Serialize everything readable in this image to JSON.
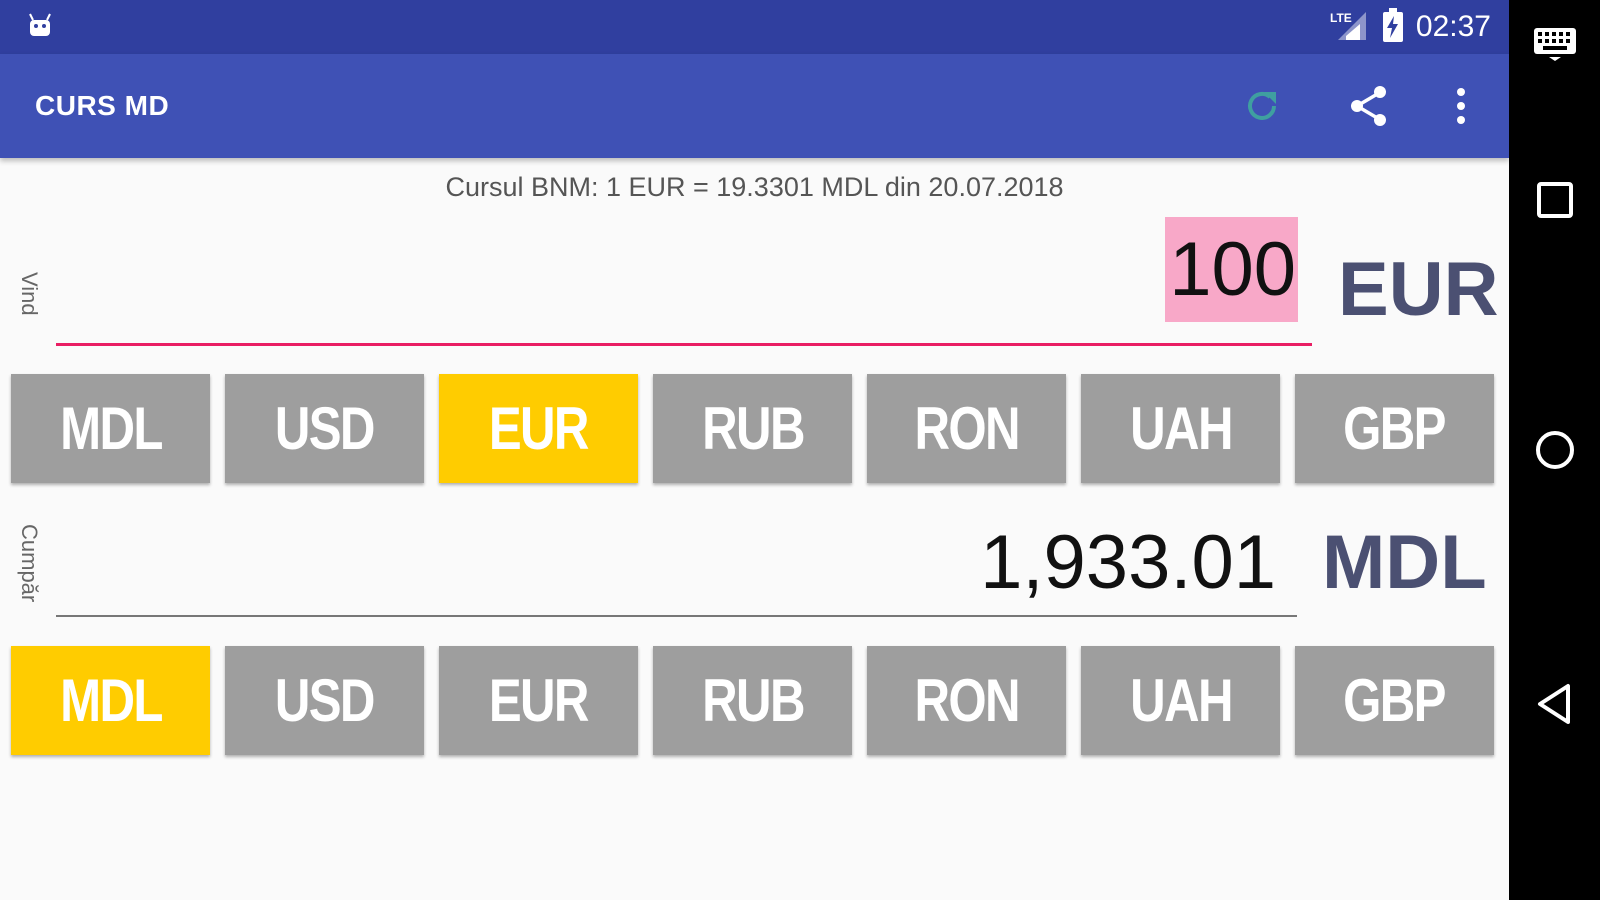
{
  "status_bar": {
    "time": "02:37",
    "network": "LTE",
    "icons": [
      "android-icon",
      "lte-signal-icon",
      "battery-charging-icon"
    ]
  },
  "app_bar": {
    "title": "CURS MD",
    "actions": [
      "refresh-icon",
      "share-icon",
      "more-vert-icon"
    ]
  },
  "rate_info": "Cursul BNM: 1 EUR = 19.3301 MDL din 20.07.2018",
  "sell": {
    "label": "Vind",
    "amount": "100",
    "currency": "EUR",
    "buttons": [
      "MDL",
      "USD",
      "EUR",
      "RUB",
      "RON",
      "UAH",
      "GBP"
    ],
    "selected": "EUR"
  },
  "buy": {
    "label": "Cumpăr",
    "amount": "1,933.01",
    "currency": "MDL",
    "buttons": [
      "MDL",
      "USD",
      "EUR",
      "RUB",
      "RON",
      "UAH",
      "GBP"
    ],
    "selected": "MDL"
  },
  "colors": {
    "status_bar": "#303f9f",
    "app_bar": "#3f51b5",
    "button": "#9e9e9e",
    "button_active": "#ffcc00",
    "accent_underline": "#e91e63",
    "selection": "#f8a8c8",
    "currency_code": "#4b5072"
  },
  "nav_bar": {
    "icons": [
      "keyboard-icon",
      "recents-square-icon",
      "home-circle-icon",
      "back-triangle-icon"
    ]
  }
}
